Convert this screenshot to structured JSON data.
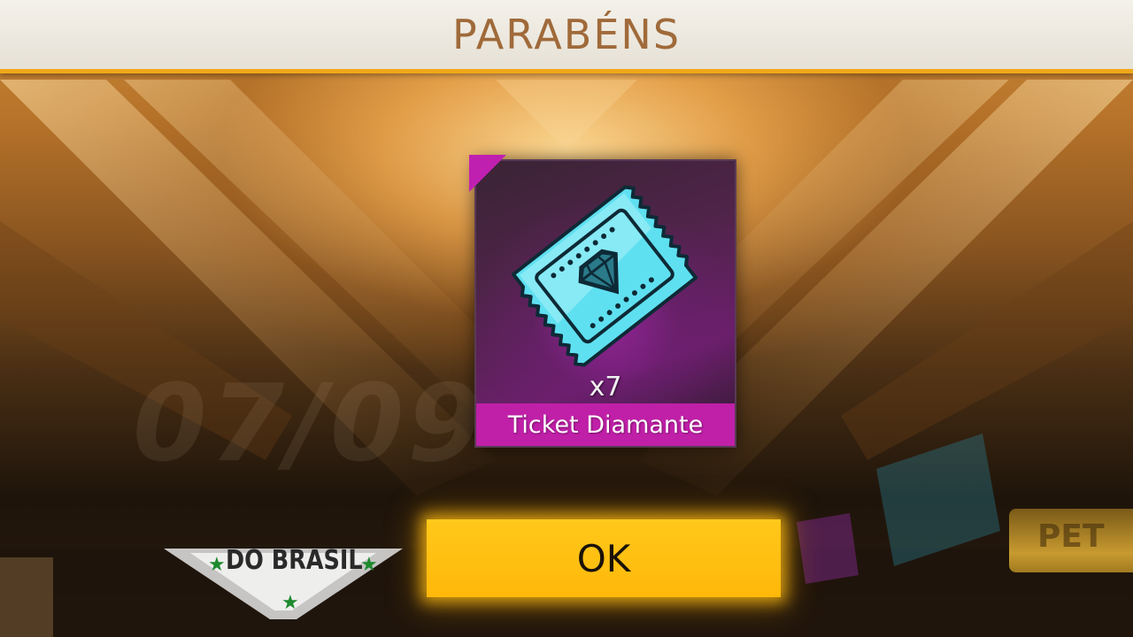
{
  "header": {
    "title": "PARABÉNS"
  },
  "reward": {
    "item_name": "Ticket Diamante",
    "quantity": "x7",
    "icon": "diamond-ticket-icon",
    "rarity_color": "#c020a8"
  },
  "actions": {
    "ok_label": "OK"
  },
  "background": {
    "date_text": "07/09",
    "banner_text": "DO BRASIL",
    "pet_text": "PET"
  },
  "colors": {
    "header_border": "#f0a818",
    "button": "#ffc10e",
    "title_text": "#a06a3a"
  }
}
